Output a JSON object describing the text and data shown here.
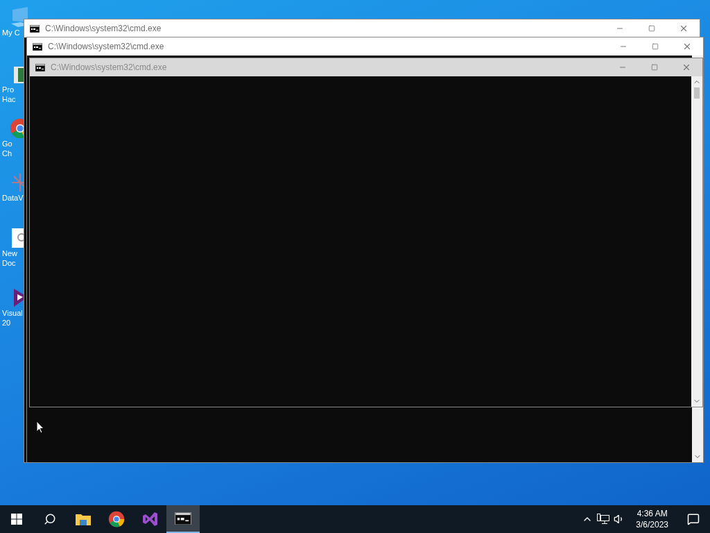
{
  "desktop_icons": [
    {
      "kind": "pc",
      "lines": [
        "My C"
      ]
    },
    {
      "kind": "tool",
      "lines": [
        "Pro",
        "Hac"
      ]
    },
    {
      "kind": "chrome",
      "lines": [
        "Go",
        "Ch"
      ]
    },
    {
      "kind": "data",
      "lines": [
        "DataV"
      ]
    },
    {
      "kind": "doc",
      "lines": [
        "New",
        "Doc"
      ]
    },
    {
      "kind": "vs",
      "lines": [
        "Visual",
        "20"
      ]
    }
  ],
  "windows": [
    {
      "title": "C:\\Windows\\system32\\cmd.exe",
      "kind": "back"
    },
    {
      "title": "C:\\Windows\\system32\\cmd.exe",
      "kind": "middle"
    },
    {
      "title": "C:\\Windows\\system32\\cmd.exe",
      "kind": "front"
    }
  ],
  "taskbar": {
    "items": [
      {
        "kind": "start",
        "selected": false
      },
      {
        "kind": "search",
        "selected": false
      },
      {
        "kind": "folder",
        "selected": false
      },
      {
        "kind": "chrome",
        "selected": false
      },
      {
        "kind": "vs",
        "selected": false
      },
      {
        "kind": "cmd",
        "selected": true
      }
    ],
    "time": "4:36 AM",
    "date": "3/6/2023"
  }
}
